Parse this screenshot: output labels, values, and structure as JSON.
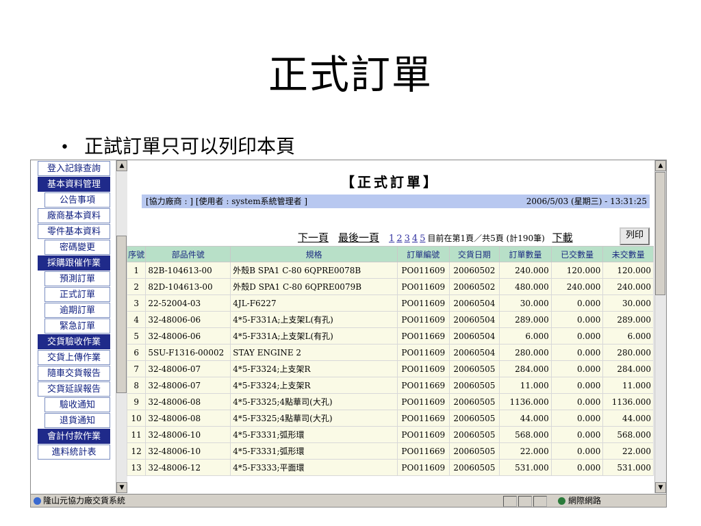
{
  "slide": {
    "title": "正式訂單",
    "bullet": "正試訂單只可以列印本頁"
  },
  "sidebar": {
    "items": [
      {
        "label": "登入記錄查詢",
        "type": "item"
      },
      {
        "label": "基本資料管理",
        "type": "section"
      },
      {
        "label": "公告事項",
        "type": "indent"
      },
      {
        "label": "廠商基本資料",
        "type": "item"
      },
      {
        "label": "零件基本資料",
        "type": "item"
      },
      {
        "label": "密碼變更",
        "type": "indent"
      },
      {
        "label": "採購跟催作業",
        "type": "section"
      },
      {
        "label": "預測訂單",
        "type": "indent"
      },
      {
        "label": "正式訂單",
        "type": "indent"
      },
      {
        "label": "逾期訂單",
        "type": "indent"
      },
      {
        "label": "緊急訂單",
        "type": "indent"
      },
      {
        "label": "交貨驗收作業",
        "type": "section"
      },
      {
        "label": "交貨上傳作業",
        "type": "item"
      },
      {
        "label": "隨車交貨報告",
        "type": "item"
      },
      {
        "label": "交貨延誤報告",
        "type": "item"
      },
      {
        "label": "驗收通知",
        "type": "indent"
      },
      {
        "label": "退貨通知",
        "type": "indent"
      },
      {
        "label": "會計付款作業",
        "type": "section"
      },
      {
        "label": "進料統計表",
        "type": "item"
      }
    ]
  },
  "form": {
    "title": "【正式訂單】",
    "info_left": "[協力廠商 :          ] [使用者 : system系統管理者 ]",
    "info_right": "2006/5/03 (星期三) - 13:31:25",
    "next_page": "下一頁",
    "last_page": "最後一頁",
    "pages": [
      "1",
      "2",
      "3",
      "4",
      "5"
    ],
    "page_status": "目前在第1頁／共5頁 (計190筆)",
    "download": "下載",
    "print": "列印"
  },
  "table": {
    "headers": [
      "序號",
      "部品件號",
      "規格",
      "訂單編號",
      "交貨日期",
      "訂單數量",
      "已交數量",
      "未交數量"
    ],
    "rows": [
      [
        "1",
        "82B-104613-00",
        "外殼B SPA1 C-80 6QPRE0078B",
        "PO011609",
        "20060502",
        "240.000",
        "120.000",
        "120.000"
      ],
      [
        "2",
        "82D-104613-00",
        "外殼D SPA1 C-80 6QPRE0079B",
        "PO011609",
        "20060502",
        "480.000",
        "240.000",
        "240.000"
      ],
      [
        "3",
        "22-52004-03",
        "4JL-F6227",
        "PO011609",
        "20060504",
        "30.000",
        "0.000",
        "30.000"
      ],
      [
        "4",
        "32-48006-06",
        "4*5-F331A;上支架L(有孔)",
        "PO011609",
        "20060504",
        "289.000",
        "0.000",
        "289.000"
      ],
      [
        "5",
        "32-48006-06",
        "4*5-F331A;上支架L(有孔)",
        "PO011669",
        "20060504",
        "6.000",
        "0.000",
        "6.000"
      ],
      [
        "6",
        "5SU-F1316-00002",
        "STAY ENGINE 2",
        "PO011609",
        "20060504",
        "280.000",
        "0.000",
        "280.000"
      ],
      [
        "7",
        "32-48006-07",
        "4*5-F3324;上支架R",
        "PO011609",
        "20060505",
        "284.000",
        "0.000",
        "284.000"
      ],
      [
        "8",
        "32-48006-07",
        "4*5-F3324;上支架R",
        "PO011669",
        "20060505",
        "11.000",
        "0.000",
        "11.000"
      ],
      [
        "9",
        "32-48006-08",
        "4*5-F3325;4點華司(大孔)",
        "PO011609",
        "20060505",
        "1136.000",
        "0.000",
        "1136.000"
      ],
      [
        "10",
        "32-48006-08",
        "4*5-F3325;4點華司(大孔)",
        "PO011669",
        "20060505",
        "44.000",
        "0.000",
        "44.000"
      ],
      [
        "11",
        "32-48006-10",
        "4*5-F3331;弧形環",
        "PO011609",
        "20060505",
        "568.000",
        "0.000",
        "568.000"
      ],
      [
        "12",
        "32-48006-10",
        "4*5-F3331;弧形環",
        "PO011669",
        "20060505",
        "22.000",
        "0.000",
        "22.000"
      ],
      [
        "13",
        "32-48006-12",
        "4*5-F3333;平面環",
        "PO011609",
        "20060505",
        "531.000",
        "0.000",
        "531.000"
      ]
    ]
  },
  "statusbar": {
    "left": "隆山元協力廠交貨系統",
    "zone": "網際網路"
  },
  "icons": {
    "scroll_up": "scroll-up-arrow-icon",
    "scroll_down": "scroll-down-arrow-icon",
    "page": "ie-page-icon",
    "zone": "globe-icon"
  }
}
